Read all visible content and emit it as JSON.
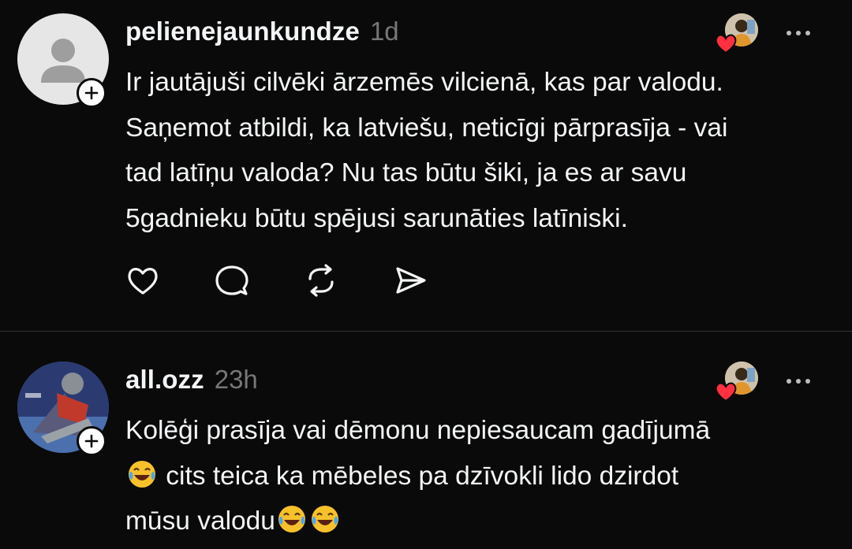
{
  "posts": [
    {
      "username": "pelienejaunkundze",
      "timestamp": "1d",
      "text": "Ir jautājuši cilvēki ārzemēs vilcienā, kas par valodu.\nSaņemot atbildi, ka latviešu, neticīgi pārprasīja - vai\ntad latīņu valoda? Nu tas būtu šiki, ja es ar savu\n5gadnieku būtu spējusi sarunāties latīniski.",
      "avatar_icon": "default-person-icon",
      "actions": [
        "heart-icon",
        "comment-icon",
        "repost-icon",
        "share-icon"
      ]
    },
    {
      "username": "all.ozz",
      "timestamp": "23h",
      "text_line1": "Kolēģi prasīja vai dēmonu nepiesaucam gadījumā",
      "text_line2": " cits teica ka mēbeles pa dzīvokli lido dzirdot",
      "text_line3": "mūsu valodu",
      "emoji_name": "face-with-tears-of-joy"
    }
  ],
  "colors": {
    "background": "#0a0a0a",
    "text": "#f3f5f7",
    "muted": "#777777",
    "like_red": "#ff3040",
    "divider": "#323232"
  }
}
